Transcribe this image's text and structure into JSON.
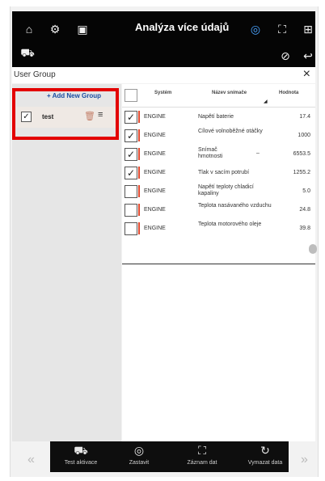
{
  "header": {
    "title": "Analýza více údajů",
    "icons": [
      "home-icon",
      "settings-icon",
      "vehicle-info-icon",
      "sensor-icon",
      "fullscreen-icon",
      "grid-icon",
      "car-icon",
      "waveform-icon",
      "back-icon"
    ]
  },
  "user_group": {
    "label": "User Group",
    "close": "×",
    "add_group": "+ Add New Group",
    "groups": [
      {
        "name": "test",
        "checked": true
      }
    ]
  },
  "table": {
    "columns": [
      "Systém",
      "Název snímače",
      "Hodnota"
    ],
    "rows": [
      {
        "checked": true,
        "system": "ENGINE",
        "name": "Napětí baterie",
        "value": "17.4"
      },
      {
        "checked": true,
        "system": "ENGINE",
        "name": "Cílové volnoběžné otáčky",
        "value": "1000"
      },
      {
        "checked": true,
        "system": "ENGINE",
        "name": "Snímač hmotnosti",
        "extra": "–",
        "value": "6553.5"
      },
      {
        "checked": true,
        "system": "ENGINE",
        "name": "Tlak v sacím potrubí",
        "value": "1255.2"
      },
      {
        "checked": false,
        "system": "ENGINE",
        "name": "Napětí teploty chladicí kapaliny",
        "value": "5.0"
      },
      {
        "checked": false,
        "system": "ENGINE",
        "name": "Teplota nasávaného vzduchu",
        "value": "24.8"
      },
      {
        "checked": false,
        "system": "ENGINE",
        "name": "Teplota motorového oleje",
        "value": "39.8"
      }
    ]
  },
  "bottom": {
    "buttons": [
      {
        "label": "Test aktivace",
        "icon": "vehicle-test-icon"
      },
      {
        "label": "Zastavit",
        "icon": "stop-icon"
      },
      {
        "label": "Záznam dat",
        "icon": "record-icon"
      },
      {
        "label": "Vymazat data",
        "icon": "refresh-icon"
      }
    ],
    "prev": "«",
    "next": "»"
  },
  "colors": {
    "accent": "#e04a2f",
    "highlight": "#e30000",
    "link": "#1a4da1"
  }
}
